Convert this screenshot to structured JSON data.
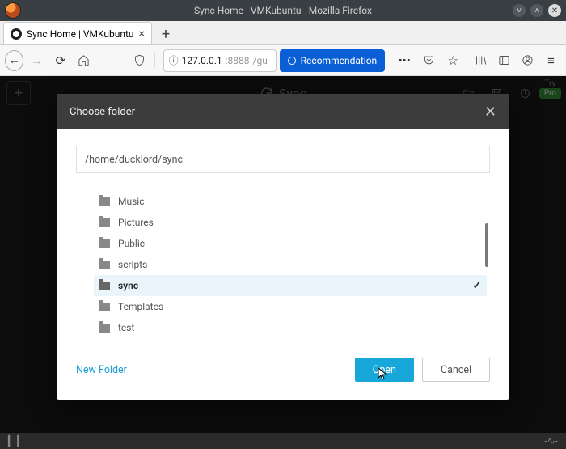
{
  "window": {
    "title": "Sync Home | VMKubuntu - Mozilla Firefox"
  },
  "tab": {
    "title": "Sync Home | VMKubuntu"
  },
  "url": {
    "host": "127.0.0.1",
    "port": ":8888",
    "path": "/gu"
  },
  "recommendation": {
    "label": "Recommendation"
  },
  "app": {
    "logo": "Sync",
    "try": "Try",
    "pro": "Pro"
  },
  "modal": {
    "title": "Choose folder",
    "path": "/home/ducklord/sync",
    "folders": [
      {
        "name": "Music",
        "selected": false
      },
      {
        "name": "Pictures",
        "selected": false
      },
      {
        "name": "Public",
        "selected": false
      },
      {
        "name": "scripts",
        "selected": false
      },
      {
        "name": "sync",
        "selected": true
      },
      {
        "name": "Templates",
        "selected": false
      },
      {
        "name": "test",
        "selected": false
      }
    ],
    "new_folder": "New Folder",
    "open": "Open",
    "cancel": "Cancel"
  }
}
